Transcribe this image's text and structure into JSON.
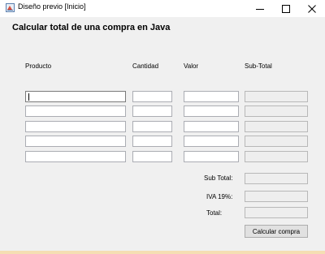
{
  "window": {
    "title": "Diseño previo [Inicio]",
    "controls": {
      "minimize": "—",
      "maximize": "☐",
      "close": "✕"
    }
  },
  "heading": "Calcular total de una compra en Java",
  "columns": {
    "producto": "Producto",
    "cantidad": "Cantidad",
    "valor": "Valor",
    "subtotal": "Sub-Total"
  },
  "rows": [
    {
      "producto": "",
      "cantidad": "",
      "valor": "",
      "subtotal": ""
    },
    {
      "producto": "",
      "cantidad": "",
      "valor": "",
      "subtotal": ""
    },
    {
      "producto": "",
      "cantidad": "",
      "valor": "",
      "subtotal": ""
    },
    {
      "producto": "",
      "cantidad": "",
      "valor": "",
      "subtotal": ""
    },
    {
      "producto": "",
      "cantidad": "",
      "valor": "",
      "subtotal": ""
    }
  ],
  "summary": {
    "subtotal_label": "Sub Total:",
    "iva_label": "IVA 19%:",
    "total_label": "Total:",
    "subtotal_value": "",
    "iva_value": "",
    "total_value": ""
  },
  "button_label": "Calcular compra"
}
